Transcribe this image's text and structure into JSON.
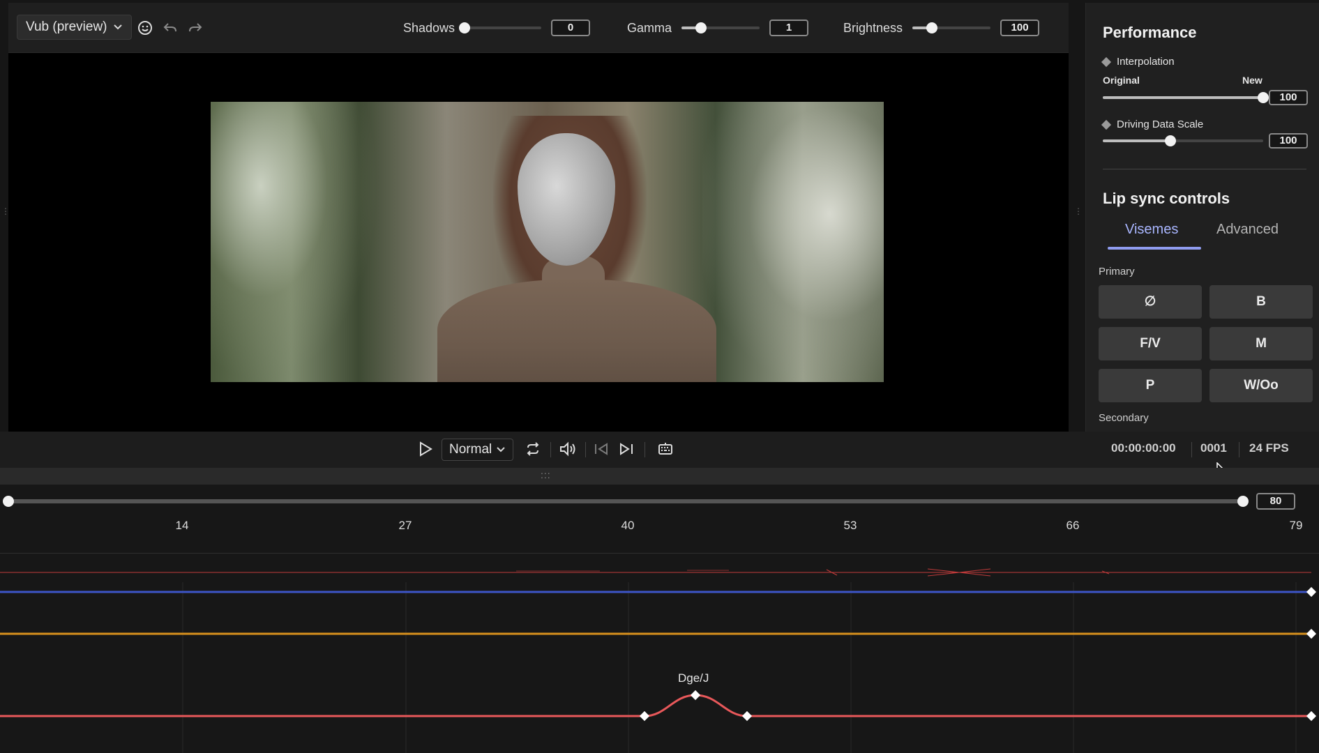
{
  "toolbar": {
    "preset": "Vub (preview)",
    "shadows": {
      "label": "Shadows",
      "value": "0",
      "level": 0
    },
    "gamma": {
      "label": "Gamma",
      "value": "1",
      "level": 0.25
    },
    "brightness": {
      "label": "Brightness",
      "value": "100",
      "level": 0.25
    },
    "icons": [
      "face-icon",
      "undo-icon",
      "redo-icon",
      "chevron-down-icon"
    ]
  },
  "playback": {
    "speed": "Normal",
    "timecode": "00:00:00:00",
    "frame": "0001",
    "fps": "24 FPS",
    "icons": [
      "play-icon",
      "loop-icon",
      "volume-icon",
      "prev-frame-icon",
      "next-frame-icon",
      "keyboard-icon"
    ]
  },
  "timeline": {
    "range_end": "80",
    "ticks": [
      "14",
      "27",
      "40",
      "53",
      "66",
      "79"
    ],
    "curve_label": "Dge/J",
    "track_colors": {
      "audio": "#c23b3b",
      "blue": "#3d55c8",
      "orange": "#d7901d",
      "red": "#e8585a"
    }
  },
  "panel": {
    "performance_title": "Performance",
    "interpolation": {
      "label": "Interpolation",
      "left": "Original",
      "right": "New",
      "value": "100",
      "level": 1.0
    },
    "driving": {
      "label": "Driving Data Scale",
      "value": "100",
      "level": 0.5
    },
    "lipsync_title": "Lip sync controls",
    "tabs": {
      "visemes": "Visemes",
      "advanced": "Advanced"
    },
    "primary_label": "Primary",
    "secondary_label": "Secondary",
    "visemes": [
      "∅",
      "B",
      "F/V",
      "M",
      "P",
      "W/Oo"
    ]
  }
}
